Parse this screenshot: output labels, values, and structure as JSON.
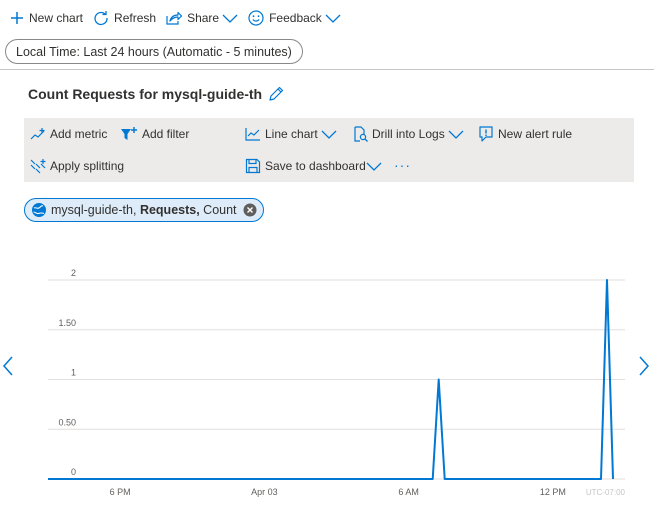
{
  "toolbar": {
    "new_chart": "New chart",
    "refresh": "Refresh",
    "share": "Share",
    "feedback": "Feedback"
  },
  "time_range": "Local Time: Last 24 hours (Automatic - 5 minutes)",
  "chart_title": "Count Requests for mysql-guide-th",
  "chart_toolbar": {
    "add_metric": "Add metric",
    "add_filter": "Add filter",
    "line_chart": "Line chart",
    "drill_into_logs": "Drill into Logs",
    "new_alert_rule": "New alert rule",
    "apply_splitting": "Apply splitting",
    "save_to_dashboard": "Save to dashboard",
    "more": "···"
  },
  "metric_pill": {
    "resource": "mysql-guide-th,",
    "metric": "Requests,",
    "aggregation": "Count"
  },
  "colors": {
    "accent": "#0078d4",
    "series": "#0078d4",
    "toolbar_bg": "#edebe9"
  },
  "chart_data": {
    "type": "line",
    "title": "",
    "xlabel": "",
    "ylabel": "",
    "ylim": [
      0,
      2
    ],
    "y_ticks": [
      "0",
      "0.50",
      "1",
      "1.50",
      "2"
    ],
    "x_ticks": [
      {
        "label": "6 PM",
        "hours": 3.0
      },
      {
        "label": "Apr 03",
        "hours": 9.0
      },
      {
        "label": "6 AM",
        "hours": 15.0
      },
      {
        "label": "12 PM",
        "hours": 21.0
      }
    ],
    "x_end_label": "UTC-07:00",
    "x_range_hours": [
      0.0,
      24.0
    ],
    "series": [
      {
        "points": [
          [
            0.0,
            0
          ],
          [
            16.0,
            0
          ],
          [
            16.25,
            1
          ],
          [
            16.5,
            0
          ],
          [
            23.0,
            0
          ],
          [
            23.25,
            2
          ],
          [
            23.5,
            0
          ]
        ]
      }
    ]
  }
}
